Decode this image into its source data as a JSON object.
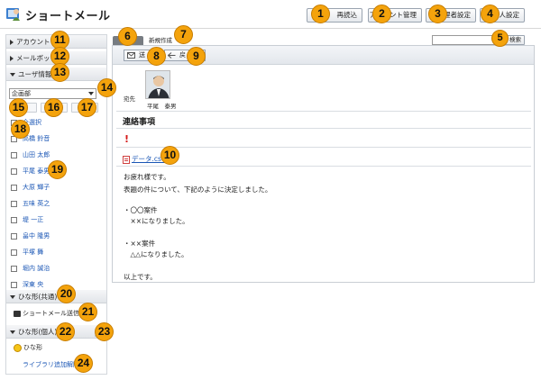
{
  "app": {
    "title": "ショートメール",
    "header_buttons": [
      "再読込",
      "アカウント管理",
      "管理者設定",
      "個人設定"
    ]
  },
  "sidebar": {
    "sections": {
      "account": "アカウント",
      "mailbox": "メールボックス",
      "user_info": "ユーザ情報",
      "template_shared": "ひな形(共通)",
      "template_personal": "ひな形(個人)"
    },
    "department": "企画部",
    "select_all": "全選択",
    "users": [
      "高橋 鈴音",
      "山田 太郎",
      "平尾 泰男",
      "大原 輝子",
      "五味 英之",
      "堤 一正",
      "畠中 隆男",
      "平塚 舞",
      "堀内 誠治",
      "深東 央"
    ],
    "shared_template_item": "ショートメール送信",
    "personal_extra": "追",
    "personal_template_item": "ひな形",
    "library_link": "ライブラリ追加解除"
  },
  "toolbar": {
    "new_tab": "新規作成",
    "search_button": "検索",
    "send_button": "送",
    "back_button": "戻"
  },
  "message": {
    "to_label": "宛先",
    "recipient": "平尾　泰男",
    "subject": "連絡事項",
    "importance_mark": "!",
    "attachment": "データ.csv",
    "body": [
      "お疲れ様です。",
      "表題の件について、下記のように決定しました。",
      "",
      "・〇〇案件",
      "　××になりました。",
      "",
      "・××案件",
      "　△△になりました。",
      "",
      "以上です。"
    ]
  },
  "markers": [
    "1",
    "2",
    "3",
    "4",
    "5",
    "6",
    "7",
    "8",
    "9",
    "10",
    "11",
    "12",
    "13",
    "14",
    "15",
    "16",
    "17",
    "18",
    "19",
    "20",
    "21",
    "22",
    "23",
    "24"
  ],
  "colors": {
    "marker": "#f4a30c",
    "link": "#1a56b5",
    "importance": "#d51a1a"
  }
}
